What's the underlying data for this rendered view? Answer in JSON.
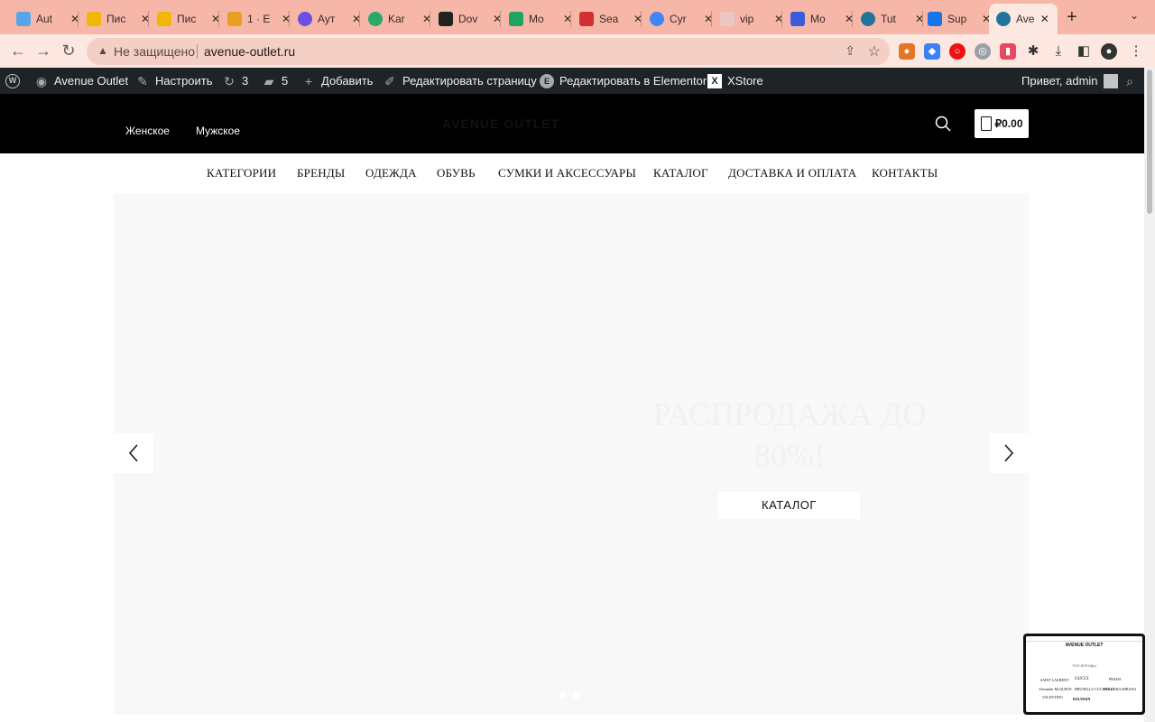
{
  "browser": {
    "tabs": [
      {
        "title": "Aut",
        "color": "#58a6e8"
      },
      {
        "title": "Пис",
        "color": "#f2b705"
      },
      {
        "title": "Пис",
        "color": "#f2b705"
      },
      {
        "title": "1 · E",
        "color": "#e8a020"
      },
      {
        "title": "Аут",
        "color": "#6b4fe0"
      },
      {
        "title": "Kar",
        "color": "#2aa86a"
      },
      {
        "title": "Dov",
        "color": "#222222"
      },
      {
        "title": "Mo",
        "color": "#1ea362"
      },
      {
        "title": "Sea",
        "color": "#d03030"
      },
      {
        "title": "Cyr",
        "color": "#4285f4"
      },
      {
        "title": "vip",
        "color": "#e8c8c0"
      },
      {
        "title": "Mo",
        "color": "#3b5bdb"
      },
      {
        "title": "Tut",
        "color": "#21759b"
      },
      {
        "title": "Sup",
        "color": "#1a73e8"
      },
      {
        "title": "Ave",
        "color": "#21759b"
      }
    ],
    "new_tab": "+",
    "tab_menu": "⌄",
    "back": "←",
    "forward": "→",
    "reload": "↻",
    "security_text": "Не защищено",
    "url": "avenue-outlet.ru"
  },
  "adminbar": {
    "site_name": "Avenue Outlet",
    "customize": "Настроить",
    "updates_count": "3",
    "comments_count": "5",
    "add_new": "Добавить",
    "edit_page": "Редактировать страницу",
    "edit_elementor": "Редактировать в Elementor",
    "xstore": "XStore",
    "greeting": "Привет, admin"
  },
  "header": {
    "women": "Женское",
    "men": "Мужское",
    "logo": "AVENUE OUTLET",
    "cart_total": "₽0.00"
  },
  "nav": {
    "items": [
      "КАТЕГОРИИ",
      "БРЕНДЫ",
      "ОДЕЖДА",
      "ОБУВЬ",
      "СУМКИ И АКСЕССУАРЫ",
      "КАТАЛОГ",
      "ДОСТАВКА И ОПЛАТА",
      "КОНТАКТЫ"
    ]
  },
  "hero": {
    "title": "РАСПРОДАЖА ДО 80%!",
    "button": "КАТАЛОГ"
  },
  "thumbnail": {
    "logo": "AVENUE OUTLET",
    "subtitle": "ТОП-БРЕНДЫ",
    "brands": [
      "SAINT LAURENT",
      "GUCCI",
      "PRADA",
      "Alexander McQUEEN",
      "BRUNELLO CUCINELLI",
      "DOLCE&GABBANA",
      "VALENTINO",
      "BALMAIN"
    ]
  }
}
